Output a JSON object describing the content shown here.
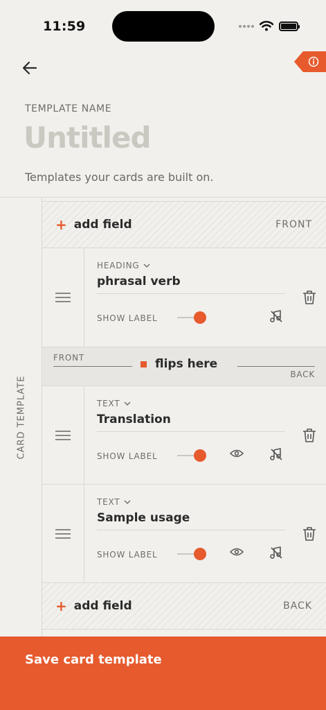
{
  "status_bar": {
    "time": "11:59"
  },
  "header": {
    "back_icon": "arrow-left-icon",
    "info_icon": "info-icon"
  },
  "template": {
    "name_label": "TEMPLATE NAME",
    "name_placeholder": "Untitled",
    "name_value": "",
    "description": "Templates your cards are built on."
  },
  "card_template": {
    "side_label": "CARD TEMPLATE",
    "front_add": {
      "label": "add field",
      "side": "FRONT"
    },
    "fields": [
      {
        "type": "HEADING",
        "name": "phrasal verb",
        "show_label": "SHOW LABEL",
        "show_label_on": true,
        "has_visibility_toggle": false
      },
      {
        "type": "TEXT",
        "name": "Translation",
        "show_label": "SHOW LABEL",
        "show_label_on": true,
        "has_visibility_toggle": true
      },
      {
        "type": "TEXT",
        "name": "Sample usage",
        "show_label": "SHOW LABEL",
        "show_label_on": true,
        "has_visibility_toggle": true
      }
    ],
    "flip": {
      "front": "FRONT",
      "label": "flips here",
      "back": "BACK"
    },
    "back_add": {
      "label": "add field",
      "side": "BACK"
    }
  },
  "save": {
    "label": "Save card template"
  },
  "colors": {
    "accent": "#e65a2e",
    "background": "#f1f0ec"
  }
}
